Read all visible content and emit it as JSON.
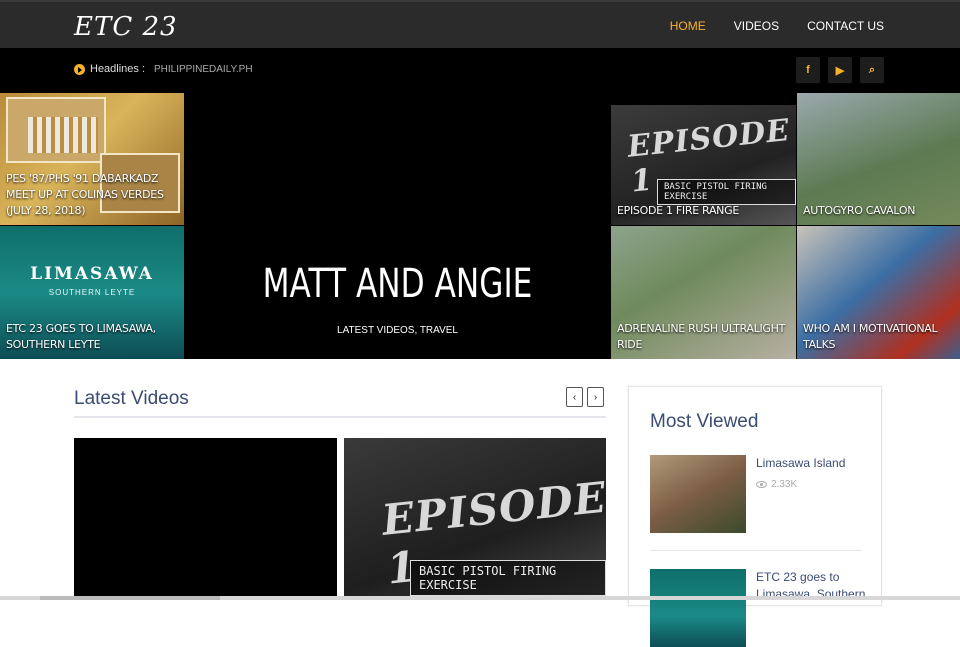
{
  "logo": "ETC 23",
  "nav": {
    "home": "HOME",
    "videos": "VIDEOS",
    "contact": "CONTACT US"
  },
  "headlines": {
    "label": "Headlines :",
    "text": "PHILIPPINEDAILY.PH"
  },
  "social": {
    "facebook": "f",
    "youtube": "▶",
    "search": "⌕"
  },
  "hero": {
    "tile1": "PES '87/PHS '91 DABARKADZ MEET UP AT COLINAS VERDES (JULY 28, 2018)",
    "tile2": {
      "caption": "ETC 23 GOES TO LIMASAWA, SOUTHERN LEYTE",
      "overlay_title": "LIMASAWA",
      "overlay_sub": "SOUTHERN LEYTE"
    },
    "center": {
      "title": "MATT AND ANGIE",
      "subtitle": "LATEST VIDEOS, TRAVEL"
    },
    "tile3": {
      "caption": "EPISODE 1 FIRE RANGE",
      "overlay_title": "EPISODE 1",
      "overlay_sub": "BASIC PISTOL FIRING EXERCISE"
    },
    "tile4": "AUTOGYRO CAVALON",
    "tile5": "ADRENALINE RUSH ULTRALIGHT RIDE",
    "tile6": "WHO AM I MOTIVATIONAL TALKS"
  },
  "latest": {
    "title": "Latest Videos",
    "prev": "‹",
    "next": "›",
    "video2": {
      "overlay_title": "EPISODE 1",
      "overlay_sub": "BASIC PISTOL FIRING EXERCISE"
    }
  },
  "most_viewed": {
    "title": "Most Viewed",
    "items": [
      {
        "title": "Limasawa Island",
        "views": "2.33K"
      },
      {
        "title": "ETC 23 goes to Limasawa, Southern",
        "views": ""
      }
    ]
  }
}
